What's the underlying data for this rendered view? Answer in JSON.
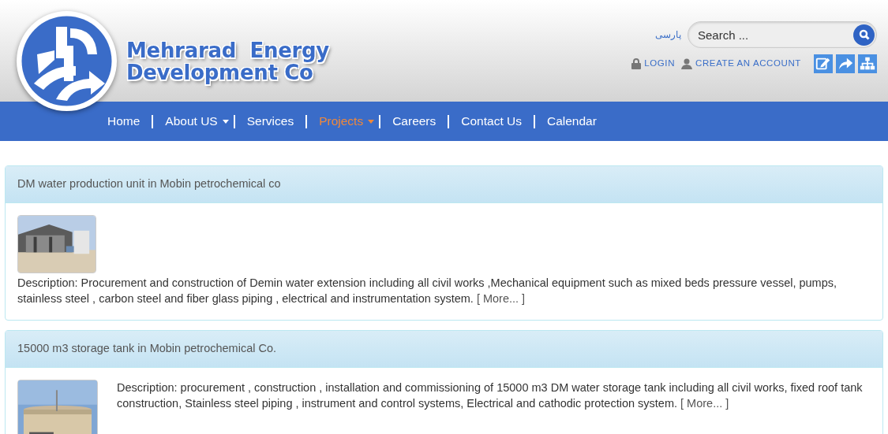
{
  "header": {
    "logo_lines": [
      "Mehrarad  Energy",
      "Development Co"
    ],
    "language_link": "پارسی",
    "search": {
      "placeholder": "Search ..."
    },
    "account_links": [
      {
        "kind": "login",
        "label": "LOGIN"
      },
      {
        "kind": "register",
        "label": "CREATE AN ACCOUNT"
      }
    ],
    "tool_icons": [
      {
        "kind": "edit"
      },
      {
        "kind": "share"
      },
      {
        "kind": "sitemap"
      }
    ]
  },
  "nav": [
    {
      "label": "Home",
      "dropdown": false,
      "selected": false
    },
    {
      "label": "About US",
      "dropdown": true,
      "selected": false
    },
    {
      "label": "Services",
      "dropdown": false,
      "selected": false
    },
    {
      "label": "Projects",
      "dropdown": true,
      "selected": true
    },
    {
      "label": "Careers",
      "dropdown": false,
      "selected": false
    },
    {
      "label": "Contact Us",
      "dropdown": false,
      "selected": false
    },
    {
      "label": "Calendar",
      "dropdown": false,
      "selected": false
    }
  ],
  "projects": [
    {
      "title": "DM water production unit in Mobin petrochemical co",
      "kind": "stacked",
      "description": "Description: Procurement and construction of Demin water extension including all civil works ,Mechanical equipment such as mixed beds pressure vessel, pumps, stainless steel , carbon steel and fiber glass piping , electrical and instrumentation system.",
      "more": "[ More... ]"
    },
    {
      "title": "15000 m3 storage tank in Mobin petrochemical Co.",
      "kind": "side",
      "description": "Description: procurement , construction , installation and commissioning of 15000 m3 DM water storage tank including all civil works, fixed roof tank construction, Stainless steel piping , instrument and control systems, Electrical and cathodic protection system.",
      "more": "[ More... ]"
    }
  ]
}
